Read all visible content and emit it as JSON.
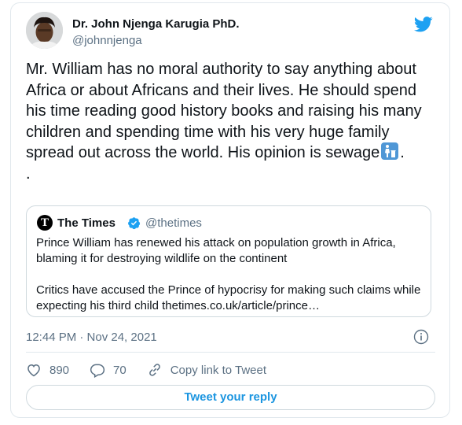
{
  "author": {
    "name": "Dr. John Njenga Karugia PhD.",
    "handle": "@johnnjenga"
  },
  "tweet": {
    "text_before_emoji": "Mr. William has no moral authority to say anything about Africa or about Africans and their lives. He should spend his time reading good history books and raising his many children and spending time with his very huge family spread out across the world. His opinion is sewage",
    "text_after_emoji": ".",
    "trailing_line": ".",
    "emoji_icon": "put-litter-in-its-place-emoji"
  },
  "quoted": {
    "logo_letter": "T",
    "name": "The Times",
    "handle": "@thetimes",
    "paragraph1": "Prince William has renewed his attack on population growth in Africa, blaming it for  destroying wildlife on the continent",
    "paragraph2": "Critics have accused the Prince of hypocrisy for making such claims while expecting his third child thetimes.co.uk/article/prince…"
  },
  "meta": {
    "timestamp": "12:44 PM · Nov 24, 2021"
  },
  "actions": {
    "likes": "890",
    "replies": "70",
    "copy_link": "Copy link to Tweet"
  },
  "reply_button": "Tweet your reply",
  "colors": {
    "accent": "#1b95e0",
    "twitter_blue": "#1da1f2",
    "secondary_text": "#5b7083",
    "border": "#e1e8ed"
  }
}
